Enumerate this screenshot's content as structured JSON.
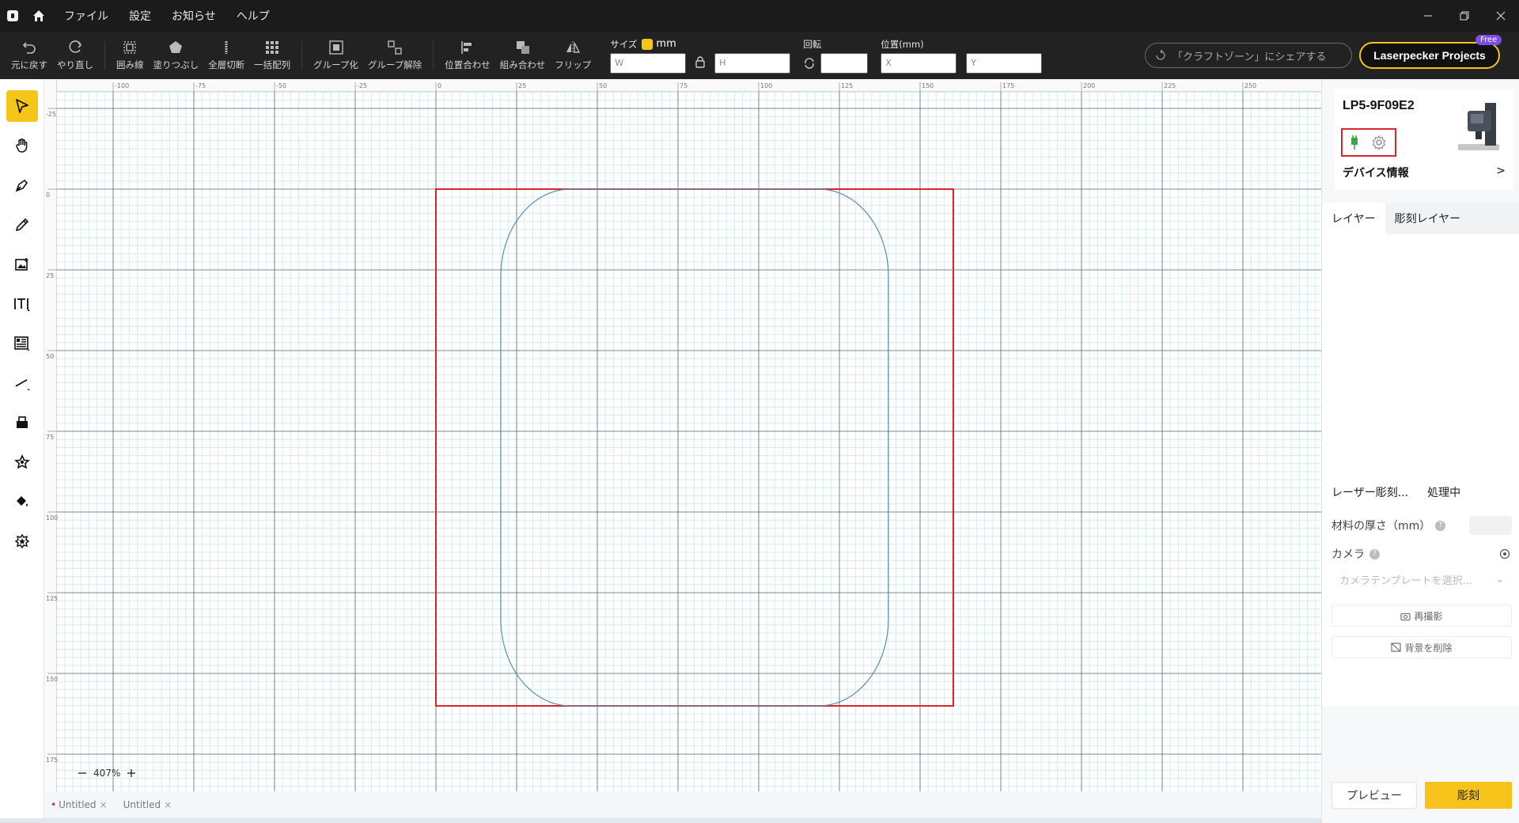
{
  "titlebar": {
    "menu": [
      {
        "label": "ファイル"
      },
      {
        "label": "設定"
      },
      {
        "label": "お知らせ"
      },
      {
        "label": "ヘルプ"
      }
    ]
  },
  "toolbar": {
    "undo": "元に戻す",
    "redo": "やり直し",
    "outline": "囲み線",
    "fill": "塗りつぶし",
    "cut": "全層切断",
    "array": "一括配列",
    "group": "グループ化",
    "ungroup": "グループ解除",
    "align": "位置合わせ",
    "combine": "組み合わせ",
    "flip": "フリップ",
    "size_label": "サイズ",
    "unit": "mm",
    "w_placeholder": "W",
    "h_placeholder": "H",
    "rotate_label": "回転",
    "position_label": "位置(mm)",
    "x_placeholder": "X",
    "y_placeholder": "Y",
    "share": "「クラフトゾーン」にシェアする",
    "projects": "Laserpecker Projects",
    "free_badge": "Free"
  },
  "canvas": {
    "zoom": "407%",
    "ruler_top": [
      "-100",
      "-75",
      "-50",
      "-25",
      "0",
      "25",
      "50",
      "75",
      "100",
      "125",
      "150",
      "175",
      "200",
      "225",
      "250"
    ],
    "ruler_left": [
      "-25",
      "0",
      "25",
      "50",
      "75",
      "100",
      "125",
      "150",
      "175"
    ]
  },
  "doc_tabs": [
    {
      "label": "Untitled",
      "modified": true
    },
    {
      "label": "Untitled",
      "modified": false
    }
  ],
  "right_panel": {
    "device_name": "LP5-9F09E2",
    "device_info": "デバイス情報",
    "layer_tabs": [
      "レイヤー",
      "彫刻レイヤー"
    ],
    "proc_tabs": [
      "レーザー彫刻...",
      "処理中"
    ],
    "material_thickness": "材料の厚さ（mm）",
    "camera": "カメラ",
    "camera_template_placeholder": "カメラテンプレートを選択...",
    "reshoot": "再撮影",
    "remove_bg": "背景を削除",
    "preview": "プレビュー",
    "engrave": "彫刻"
  },
  "colors": {
    "accent": "#f5c518",
    "selection": "#d8262f",
    "shape_stroke": "#5b8db3"
  }
}
